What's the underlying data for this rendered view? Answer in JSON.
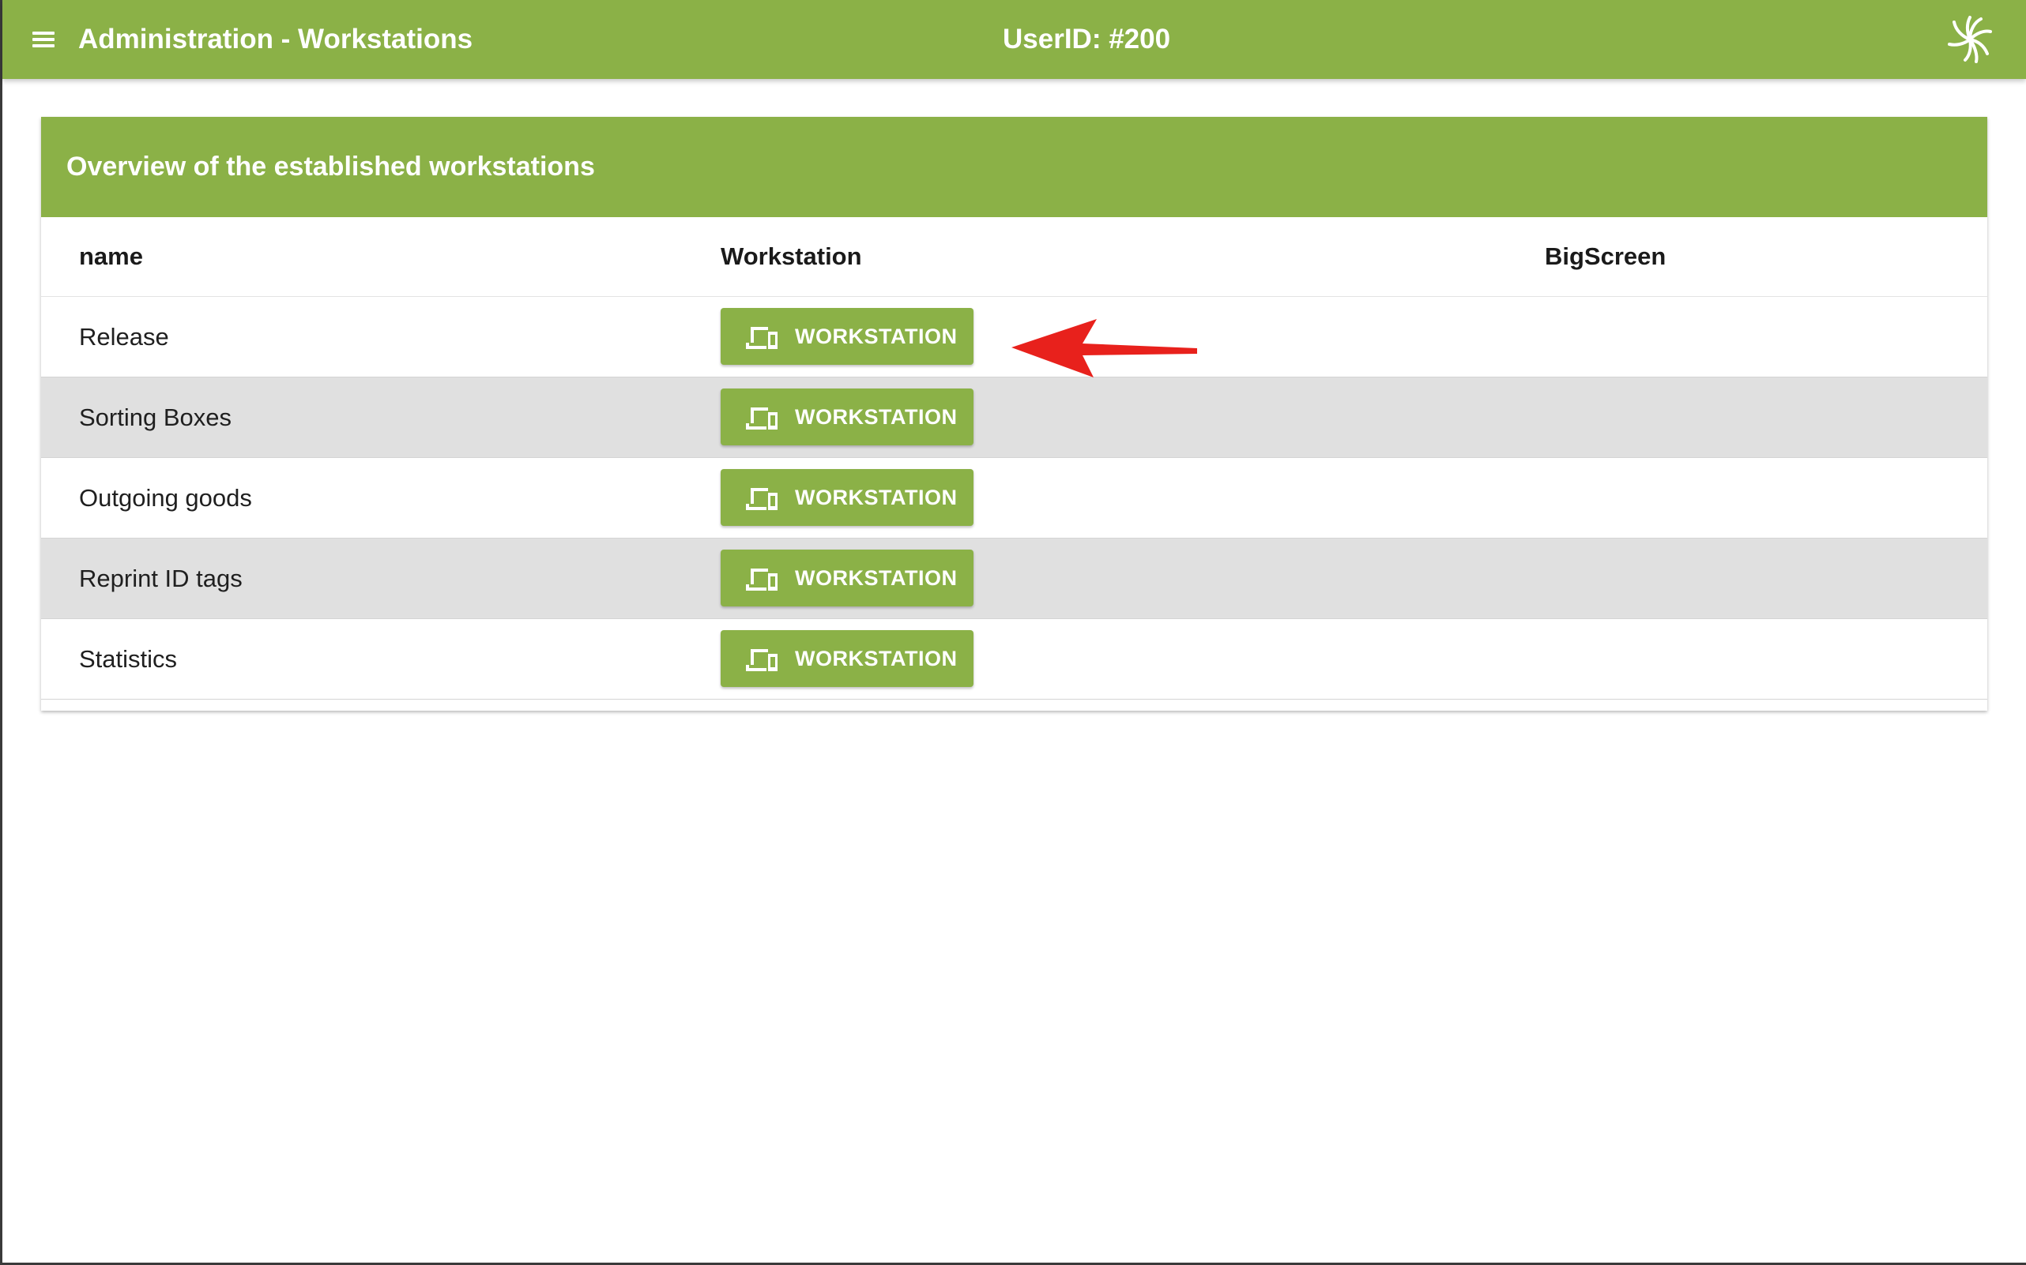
{
  "app": {
    "title": "Administration - Workstations",
    "user_id": "UserID: #200",
    "menu_icon": "hamburger-menu-icon",
    "logo_icon": "swirl-logo-icon"
  },
  "card": {
    "title": "Overview of the established workstations"
  },
  "table": {
    "columns": [
      "name",
      "Workstation",
      "BigScreen"
    ],
    "button_icon": "devices-icon",
    "rows": [
      {
        "name": "Release",
        "workstation_button": "WORKSTATION",
        "bigscreen": ""
      },
      {
        "name": "Sorting Boxes",
        "workstation_button": "WORKSTATION",
        "bigscreen": ""
      },
      {
        "name": "Outgoing goods",
        "workstation_button": "WORKSTATION",
        "bigscreen": ""
      },
      {
        "name": "Reprint ID tags",
        "workstation_button": "WORKSTATION",
        "bigscreen": ""
      },
      {
        "name": "Statistics",
        "workstation_button": "WORKSTATION",
        "bigscreen": ""
      }
    ]
  },
  "annotation": {
    "icon": "red-arrow-icon",
    "points_to": "Release"
  },
  "colors": {
    "brand_green": "#8bb147",
    "row_alt": "#e0e0e0",
    "annotation_red": "#e8211c",
    "text_dark": "#1f1f1f",
    "white": "#ffffff"
  }
}
